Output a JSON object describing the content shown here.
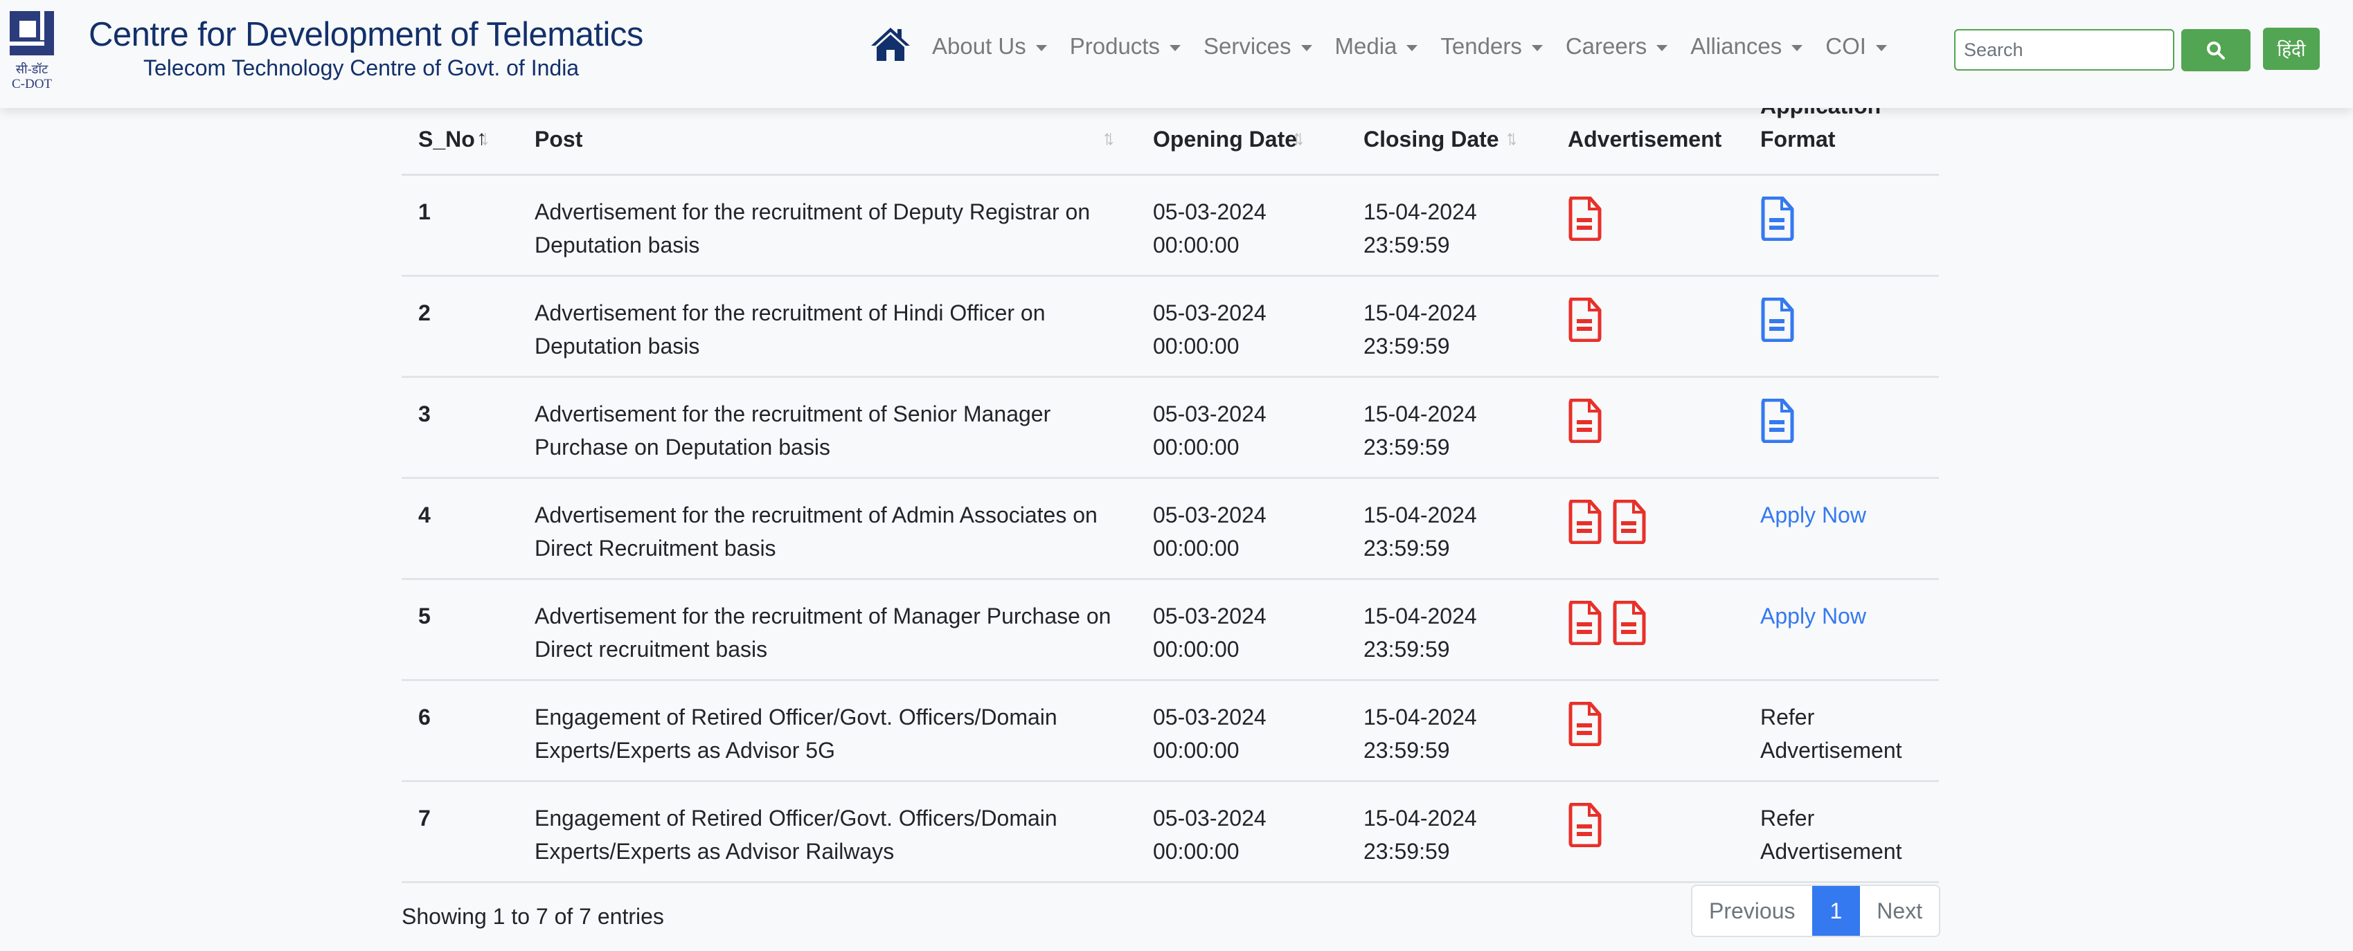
{
  "header": {
    "logo_hindi": "सी-डॉट",
    "logo_english": "C-DOT",
    "title": "Centre for Development of Telematics",
    "subtitle": "Telecom Technology Centre of Govt. of India",
    "home_icon": "home-icon",
    "nav": [
      {
        "label": "About Us"
      },
      {
        "label": "Products"
      },
      {
        "label": "Services"
      },
      {
        "label": "Media"
      },
      {
        "label": "Tenders"
      },
      {
        "label": "Careers"
      },
      {
        "label": "Alliances"
      },
      {
        "label": "COI"
      }
    ],
    "search_placeholder": "Search",
    "search_icon": "search-icon",
    "language_button": "हिंदी"
  },
  "colors": {
    "brand": "#12306b",
    "green": "#52a552",
    "pdf_red": "#e8302a",
    "doc_blue": "#3479f0",
    "link_blue": "#3479f0"
  },
  "table": {
    "columns": [
      "S_No",
      "Post",
      "Opening Date",
      "Closing Date",
      "Advertisement",
      "Application Format"
    ],
    "sort": {
      "column": "S_No",
      "direction": "asc"
    },
    "rows": [
      {
        "sno": "1",
        "post": "Advertisement for the recruitment of Deputy Registrar on Deputation basis",
        "opening": "05-03-2024 00:00:00",
        "closing": "15-04-2024 23:59:59",
        "ad_docs": 1,
        "format": {
          "type": "doc-icon"
        }
      },
      {
        "sno": "2",
        "post": "Advertisement for the recruitment of Hindi Officer on Deputation basis",
        "opening": "05-03-2024 00:00:00",
        "closing": "15-04-2024 23:59:59",
        "ad_docs": 1,
        "format": {
          "type": "doc-icon"
        }
      },
      {
        "sno": "3",
        "post": "Advertisement for the recruitment of Senior Manager Purchase on Deputation basis",
        "opening": "05-03-2024 00:00:00",
        "closing": "15-04-2024 23:59:59",
        "ad_docs": 1,
        "format": {
          "type": "doc-icon"
        }
      },
      {
        "sno": "4",
        "post": "Advertisement for the recruitment of Admin Associates on Direct Recruitment basis",
        "opening": "05-03-2024 00:00:00",
        "closing": "15-04-2024 23:59:59",
        "ad_docs": 2,
        "format": {
          "type": "link",
          "text": "Apply Now"
        }
      },
      {
        "sno": "5",
        "post": "Advertisement for the recruitment of Manager Purchase on Direct recruitment basis",
        "opening": "05-03-2024 00:00:00",
        "closing": "15-04-2024 23:59:59",
        "ad_docs": 2,
        "format": {
          "type": "link",
          "text": "Apply Now"
        }
      },
      {
        "sno": "6",
        "post": "Engagement of Retired Officer/Govt. Officers/Domain Experts/Experts as Advisor 5G",
        "opening": "05-03-2024 00:00:00",
        "closing": "15-04-2024 23:59:59",
        "ad_docs": 1,
        "format": {
          "type": "text",
          "text": "Refer Advertisement"
        }
      },
      {
        "sno": "7",
        "post": "Engagement of Retired Officer/Govt. Officers/Domain Experts/Experts as Advisor Railways",
        "opening": "05-03-2024 00:00:00",
        "closing": "15-04-2024 23:59:59",
        "ad_docs": 1,
        "format": {
          "type": "text",
          "text": "Refer Advertisement"
        }
      }
    ]
  },
  "footer": {
    "info": "Showing 1 to 7 of 7 entries",
    "pagination": {
      "previous": "Previous",
      "current": "1",
      "next": "Next"
    }
  }
}
